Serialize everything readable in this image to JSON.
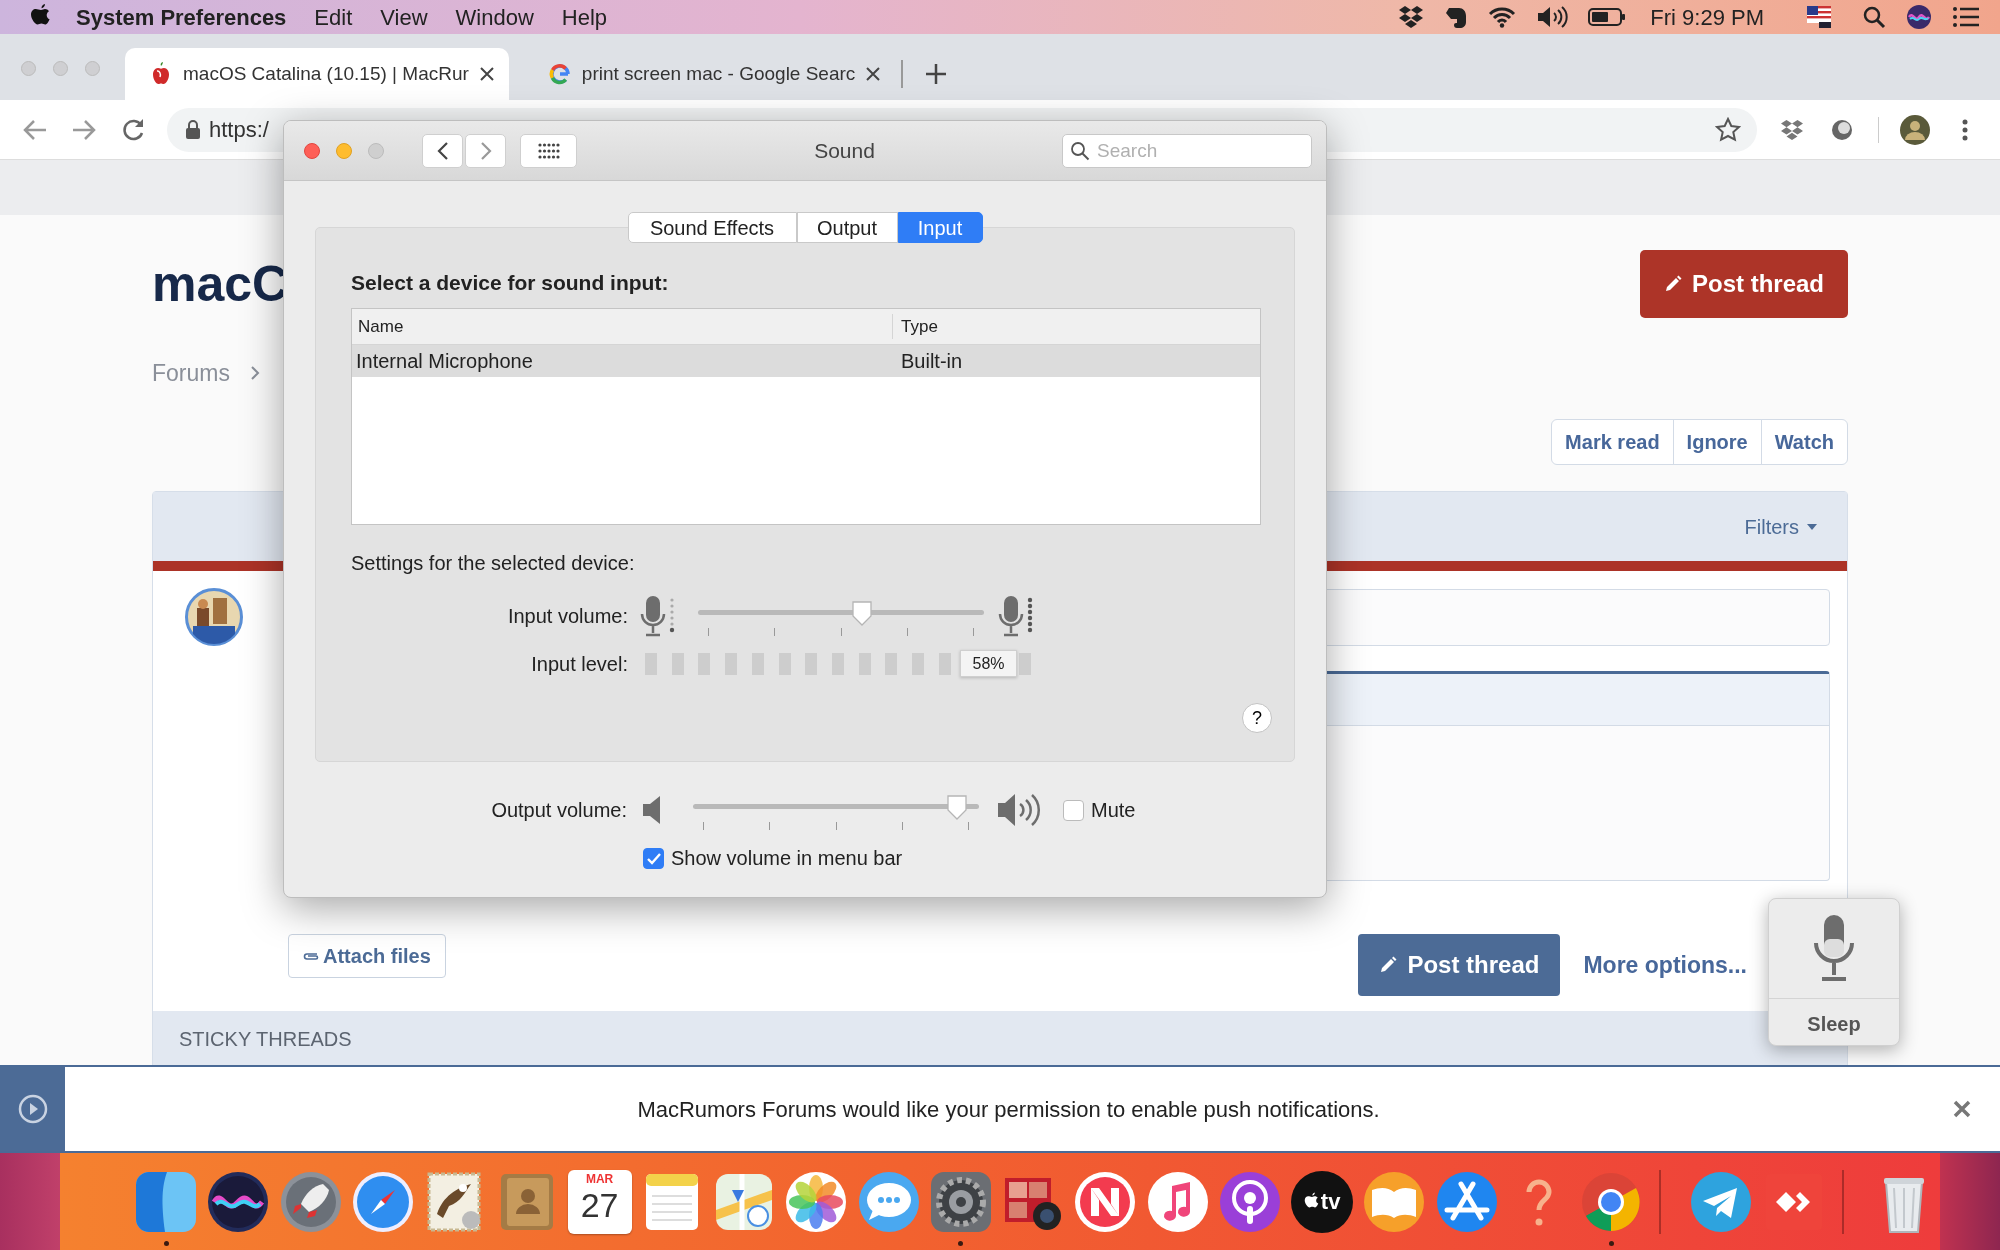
{
  "menu_bar": {
    "app_name": "System Preferences",
    "menus": [
      "Edit",
      "View",
      "Window",
      "Help"
    ],
    "clock": "Fri 9:29 PM"
  },
  "browser": {
    "tabs": [
      {
        "title": "macOS Catalina (10.15) | MacRur",
        "selected": true,
        "kind": "apple"
      },
      {
        "title": "print screen mac - Google Searc",
        "selected": false,
        "kind": "g"
      }
    ],
    "address": "https:/"
  },
  "page": {
    "title": "macC",
    "breadcrumb": "Forums",
    "post_thread_top": "Post thread",
    "actions": [
      "Mark read",
      "Ignore",
      "Watch"
    ],
    "filters": "Filters",
    "attach_files": "Attach files",
    "post_thread": "Post thread",
    "more_options": "More options...",
    "sticky_threads": "STICKY THREADS"
  },
  "sound_window": {
    "title": "Sound",
    "search_placeholder": "Search",
    "tabs": [
      {
        "label": "Sound Effects",
        "selected": false
      },
      {
        "label": "Output",
        "selected": false
      },
      {
        "label": "Input",
        "selected": true
      }
    ],
    "device_heading": "Select a device for sound input:",
    "table": {
      "columns": [
        "Name",
        "Type"
      ],
      "rows": [
        {
          "cells": [
            "Internal Microphone",
            "Built-in"
          ],
          "selected": true
        }
      ]
    },
    "settings_heading": "Settings for the selected device:",
    "input_volume": {
      "label": "Input volume:",
      "level": 0.58
    },
    "input_level": {
      "label": "Input level:",
      "level": 0,
      "tooltip": "58%"
    },
    "output_volume": {
      "label": "Output volume:",
      "level": 0.96
    },
    "mute": {
      "label": "Mute",
      "checked": false
    },
    "show_volume": {
      "label": "Show volume in menu bar",
      "checked": true
    },
    "help_label": "?"
  },
  "voice_hud": {
    "label": "Sleep"
  },
  "notification": {
    "text": "MacRumors Forums would like your permission to ",
    "link": "enable push notifications",
    "end": "."
  },
  "dock": [
    {
      "kind": "finder",
      "running": true
    },
    {
      "kind": "siri",
      "running": false
    },
    {
      "kind": "launchpad",
      "running": false
    },
    {
      "kind": "safari",
      "running": false
    },
    {
      "kind": "mail",
      "running": false
    },
    {
      "kind": "contacts",
      "running": false
    },
    {
      "kind": "calendar",
      "running": false,
      "month": "MAR",
      "day": "27"
    },
    {
      "kind": "notes",
      "running": false
    },
    {
      "kind": "maps",
      "running": false
    },
    {
      "kind": "photos",
      "running": false
    },
    {
      "kind": "messages",
      "running": false
    },
    {
      "kind": "sysprefs",
      "running": true
    },
    {
      "kind": "photobooth",
      "running": false
    },
    {
      "kind": "news",
      "running": false
    },
    {
      "kind": "music",
      "running": false
    },
    {
      "kind": "podcasts",
      "running": false
    },
    {
      "kind": "tv",
      "running": false,
      "label": "tv"
    },
    {
      "kind": "books",
      "running": false
    },
    {
      "kind": "appstore",
      "running": false
    },
    {
      "kind": "help",
      "running": false
    },
    {
      "kind": "chrome",
      "running": true
    },
    {
      "kind": "separator"
    },
    {
      "kind": "telegram",
      "running": false
    },
    {
      "kind": "anydesk",
      "running": false
    },
    {
      "kind": "separator"
    },
    {
      "kind": "trash",
      "running": false
    }
  ]
}
